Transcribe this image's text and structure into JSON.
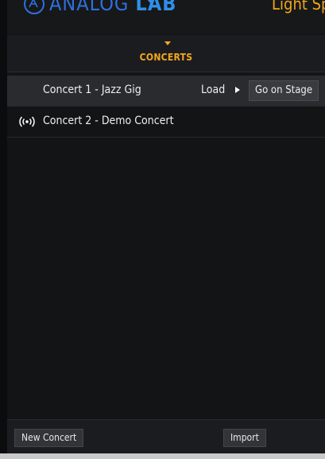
{
  "header": {
    "brand_light": "ANALOG ",
    "brand_bold": "LAB",
    "preset_name": "Light Spri",
    "accent_blue": "#2f8fe8"
  },
  "concerts": {
    "title": "CONCERTS",
    "accent": "#f2a81d"
  },
  "list": {
    "items": [
      {
        "title": "Concert 1 - Jazz Gig",
        "selected": true,
        "load_label": "Load",
        "stage_label": "Go on Stage"
      },
      {
        "title": "Concert 2 - Demo Concert",
        "live": true,
        "live_icon": "broadcast-icon"
      }
    ]
  },
  "footer": {
    "new_label": "New Concert",
    "import_label": "Import"
  }
}
